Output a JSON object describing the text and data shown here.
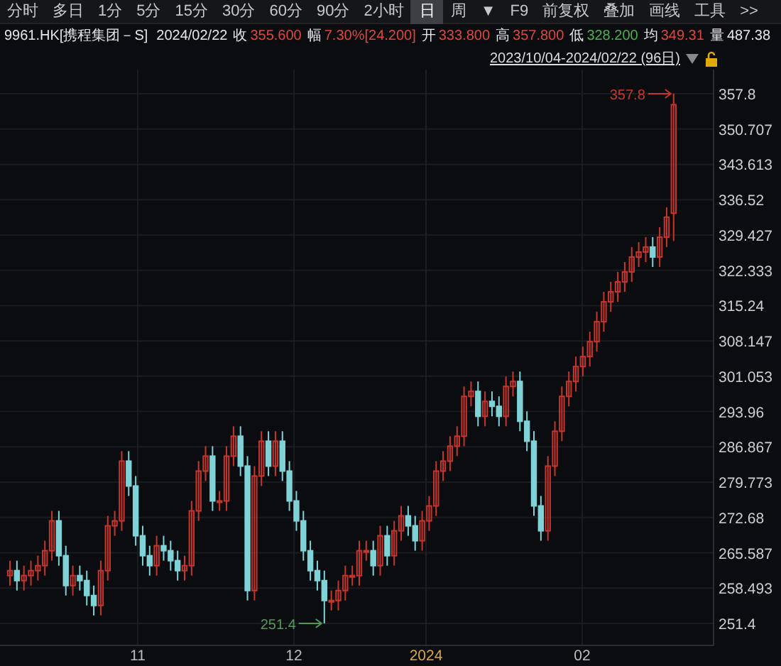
{
  "toolbar": [
    {
      "label": "分时",
      "selected": false
    },
    {
      "label": "多日",
      "selected": false
    },
    {
      "label": "1分",
      "selected": false
    },
    {
      "label": "5分",
      "selected": false
    },
    {
      "label": "15分",
      "selected": false
    },
    {
      "label": "30分",
      "selected": false
    },
    {
      "label": "60分",
      "selected": false
    },
    {
      "label": "90分",
      "selected": false
    },
    {
      "label": "2小时",
      "selected": false
    },
    {
      "label": "日",
      "selected": true
    },
    {
      "label": "周",
      "selected": false
    },
    {
      "label": "▼",
      "selected": false
    },
    {
      "label": "F9",
      "selected": false
    },
    {
      "label": "前复权",
      "selected": false
    },
    {
      "label": "叠加",
      "selected": false
    },
    {
      "label": "画线",
      "selected": false
    },
    {
      "label": "工具",
      "selected": false
    },
    {
      "label": ">>",
      "selected": false
    }
  ],
  "quote": {
    "symbol": "9961.HK[携程集团－S]",
    "date": "2024/02/22",
    "fields": [
      {
        "label": "收",
        "value": "355.600",
        "color": "#e0463c"
      },
      {
        "label": "幅",
        "value": "7.30%[24.200]",
        "color": "#e0463c"
      },
      {
        "label": "开",
        "value": "333.800",
        "color": "#e0463c"
      },
      {
        "label": "高",
        "value": "357.800",
        "color": "#e0463c"
      },
      {
        "label": "低",
        "value": "328.200",
        "color": "#4caf50"
      },
      {
        "label": "均",
        "value": "349.31",
        "color": "#e0463c"
      },
      {
        "label": "量",
        "value": "487.38",
        "color": "#e6e6e6"
      }
    ]
  },
  "range": {
    "label": "2023/10/04-2024/02/22 (96日)",
    "locked": false
  },
  "chart": {
    "x_labels": [
      {
        "label": "11",
        "highlight": false
      },
      {
        "label": "12",
        "highlight": false
      },
      {
        "label": "2024",
        "highlight": true
      },
      {
        "label": "02",
        "highlight": false
      }
    ],
    "high_marker": "357.8",
    "low_marker": "251.4",
    "chart_data": {
      "type": "candlestick",
      "grid": true,
      "ylim": [
        251.4,
        357.8
      ],
      "yticks": [
        {
          "value": 357.8,
          "label": "357.8"
        },
        {
          "value": 350.707,
          "label": "350.707"
        },
        {
          "value": 343.613,
          "label": "343.613"
        },
        {
          "value": 336.52,
          "label": "336.52"
        },
        {
          "value": 329.427,
          "label": "329.427"
        },
        {
          "value": 322.333,
          "label": "322.333"
        },
        {
          "value": 315.24,
          "label": "315.24"
        },
        {
          "value": 308.147,
          "label": "308.147"
        },
        {
          "value": 301.053,
          "label": "301.053"
        },
        {
          "value": 293.96,
          "label": "293.96"
        },
        {
          "value": 286.867,
          "label": "286.867"
        },
        {
          "value": 279.773,
          "label": "279.773"
        },
        {
          "value": 272.68,
          "label": "272.68"
        },
        {
          "value": 265.587,
          "label": "265.587"
        },
        {
          "value": 258.493,
          "label": "258.493"
        },
        {
          "value": 251.4,
          "label": "251.4"
        }
      ],
      "ohlc": [
        [
          261,
          264,
          259,
          262
        ],
        [
          262,
          264,
          258,
          260
        ],
        [
          260,
          263,
          258,
          261
        ],
        [
          261,
          264,
          259,
          262
        ],
        [
          262,
          265,
          260,
          263
        ],
        [
          263,
          268,
          261,
          266
        ],
        [
          266,
          274,
          264,
          272
        ],
        [
          272,
          274,
          263,
          265
        ],
        [
          265,
          267,
          257,
          259
        ],
        [
          259,
          263,
          257,
          261
        ],
        [
          261,
          263,
          258,
          260
        ],
        [
          260,
          262,
          255,
          257
        ],
        [
          257,
          259,
          253,
          255
        ],
        [
          255,
          264,
          253,
          262
        ],
        [
          262,
          273,
          260,
          271
        ],
        [
          271,
          274,
          269,
          272
        ],
        [
          272,
          286,
          270,
          284
        ],
        [
          284,
          286,
          277,
          279
        ],
        [
          279,
          281,
          267,
          269
        ],
        [
          269,
          271,
          263,
          265
        ],
        [
          265,
          267,
          261,
          263
        ],
        [
          263,
          269,
          261,
          267
        ],
        [
          267,
          269,
          264,
          266
        ],
        [
          266,
          268,
          262,
          264
        ],
        [
          264,
          266,
          260,
          262
        ],
        [
          262,
          265,
          260,
          263
        ],
        [
          263,
          276,
          261,
          274
        ],
        [
          274,
          284,
          272,
          282
        ],
        [
          282,
          287,
          280,
          285
        ],
        [
          285,
          287,
          274,
          276
        ],
        [
          276,
          278,
          274,
          276
        ],
        [
          276,
          287,
          274,
          285
        ],
        [
          285,
          291,
          283,
          289
        ],
        [
          289,
          291,
          281,
          283
        ],
        [
          283,
          285,
          256,
          258
        ],
        [
          258,
          283,
          256,
          281
        ],
        [
          281,
          290,
          279,
          288
        ],
        [
          288,
          290,
          281,
          283
        ],
        [
          283,
          290,
          281,
          288
        ],
        [
          288,
          290,
          280,
          282
        ],
        [
          282,
          284,
          274,
          276
        ],
        [
          276,
          278,
          270,
          272
        ],
        [
          272,
          274,
          264,
          266
        ],
        [
          266,
          268,
          260,
          262
        ],
        [
          262,
          264,
          258,
          260
        ],
        [
          260,
          262,
          251.4,
          256
        ],
        [
          256,
          258,
          254,
          256
        ],
        [
          256,
          260,
          254,
          258
        ],
        [
          258,
          263,
          256,
          261
        ],
        [
          261,
          263,
          259,
          261
        ],
        [
          261,
          268,
          259,
          266
        ],
        [
          266,
          268,
          264,
          266
        ],
        [
          266,
          268,
          261,
          263
        ],
        [
          263,
          271,
          261,
          269
        ],
        [
          269,
          271,
          263,
          265
        ],
        [
          265,
          272,
          263,
          270
        ],
        [
          270,
          275,
          268,
          273
        ],
        [
          273,
          275,
          269,
          271
        ],
        [
          271,
          273,
          266,
          268
        ],
        [
          268,
          274,
          266,
          272
        ],
        [
          272,
          277,
          270,
          275
        ],
        [
          275,
          284,
          273,
          282
        ],
        [
          282,
          286,
          280,
          284
        ],
        [
          284,
          289,
          282,
          287
        ],
        [
          287,
          291,
          285,
          289
        ],
        [
          289,
          299,
          287,
          297
        ],
        [
          297,
          300,
          295,
          298
        ],
        [
          298,
          300,
          291,
          293
        ],
        [
          293,
          298,
          291,
          296
        ],
        [
          296,
          298,
          293,
          295
        ],
        [
          295,
          297,
          291,
          293
        ],
        [
          293,
          301,
          291,
          299
        ],
        [
          299,
          302,
          297,
          300
        ],
        [
          300,
          302,
          290,
          292
        ],
        [
          292,
          294,
          286,
          288
        ],
        [
          288,
          290,
          273,
          275
        ],
        [
          275,
          277,
          268,
          270
        ],
        [
          270,
          285,
          268,
          283
        ],
        [
          283,
          292,
          281,
          290
        ],
        [
          290,
          299,
          288,
          297
        ],
        [
          297,
          302,
          295,
          300
        ],
        [
          300,
          305,
          298,
          303
        ],
        [
          303,
          307,
          301,
          305
        ],
        [
          305,
          310,
          303,
          308
        ],
        [
          308,
          314,
          306,
          312
        ],
        [
          312,
          318,
          310,
          316
        ],
        [
          316,
          320,
          314,
          318
        ],
        [
          318,
          322,
          316,
          320
        ],
        [
          320,
          324,
          318,
          322
        ],
        [
          322,
          327,
          320,
          325
        ],
        [
          325,
          328,
          323,
          326
        ],
        [
          326,
          329,
          324,
          327
        ],
        [
          327,
          329,
          323,
          325
        ],
        [
          325,
          331,
          323,
          329
        ],
        [
          329,
          335,
          327,
          333
        ],
        [
          333.8,
          357.8,
          328.2,
          355.6
        ]
      ]
    }
  }
}
